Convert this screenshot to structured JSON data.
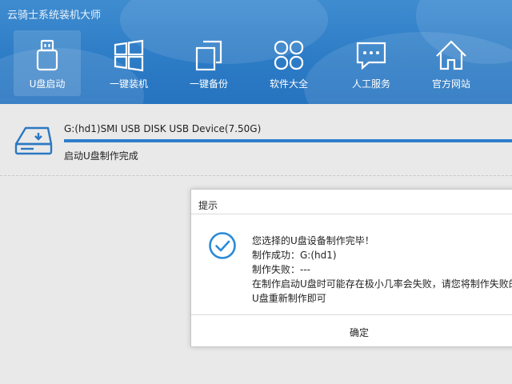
{
  "app": {
    "title": "云骑士系统装机大师"
  },
  "nav": {
    "items": [
      {
        "label": "U盘启动",
        "icon": "usb-drive-icon",
        "active": true
      },
      {
        "label": "一键装机",
        "icon": "windows-icon",
        "active": false
      },
      {
        "label": "一键备份",
        "icon": "backup-copy-icon",
        "active": false
      },
      {
        "label": "软件大全",
        "icon": "apps-grid-icon",
        "active": false
      },
      {
        "label": "人工服务",
        "icon": "chat-bubble-icon",
        "active": false
      },
      {
        "label": "官方网站",
        "icon": "home-icon",
        "active": false
      }
    ]
  },
  "device": {
    "name": "G:(hd1)SMI USB DISK USB Device(7.50G)",
    "progress": 1.0,
    "status": "启动U盘制作完成"
  },
  "dialog": {
    "title": "提示",
    "lines": [
      "您选择的U盘设备制作完毕！",
      "制作成功：G:(hd1)",
      "制作失败：---",
      "在制作启动U盘时可能存在极小几率会失败，请您将制作失败的",
      "U盘重新制作即可"
    ],
    "ok_label": "确定"
  },
  "colors": {
    "header": "#2d7cc6",
    "accent": "#2e7fcc",
    "check": "#2b8ad8"
  }
}
